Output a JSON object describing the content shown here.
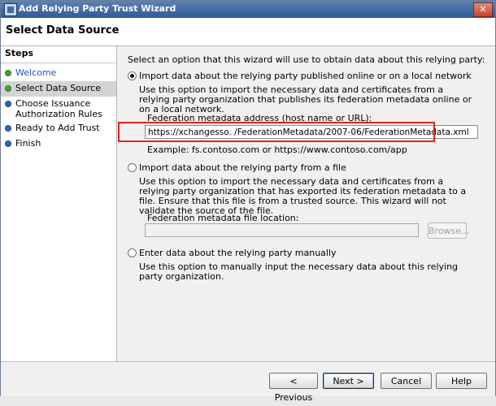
{
  "window": {
    "title": "Add Relying Party Trust Wizard",
    "close_glyph": "✕"
  },
  "header": {
    "title": "Select Data Source"
  },
  "steps": {
    "heading": "Steps",
    "items": [
      {
        "label": "Welcome",
        "status": "complete"
      },
      {
        "label": "Select Data Source",
        "status": "current"
      },
      {
        "label": "Choose Issuance Authorization Rules",
        "status": "pending"
      },
      {
        "label": "Ready to Add Trust",
        "status": "pending"
      },
      {
        "label": "Finish",
        "status": "pending"
      }
    ]
  },
  "main": {
    "intro": "Select an option that this wizard will use to obtain data about this relying party:",
    "option_online": {
      "label": "Import data about the relying party published online or on a local network",
      "selected": true,
      "description": "Use this option to import the necessary data and certificates from a relying party organization that publishes its federation metadata online or on a local network.",
      "field_label": "Federation metadata address (host name or URL):",
      "field_value": "https://xchangesso.          /FederationMetadata/2007-06/FederationMetadata.xml",
      "example": "Example: fs.contoso.com or https://www.contoso.com/app"
    },
    "option_file": {
      "label": "Import data about the relying party from a file",
      "selected": false,
      "description": "Use this option to import the necessary data and certificates from a relying party organization that has exported its federation metadata to a file. Ensure that this file is from a trusted source.  This wizard will not validate the source of the file.",
      "field_label": "Federation metadata file location:",
      "field_value": "",
      "browse_label": "Browse..."
    },
    "option_manual": {
      "label": "Enter data about the relying party manually",
      "selected": false,
      "description": "Use this option to manually input the necessary data about this relying party organization."
    }
  },
  "buttons": {
    "previous": "< Previous",
    "next": "Next >",
    "cancel": "Cancel",
    "help": "Help"
  },
  "colors": {
    "highlight": "#e2241b",
    "complete_dot": "#3fa53a",
    "pending_dot": "#2f63c6",
    "link": "#2152c9"
  }
}
